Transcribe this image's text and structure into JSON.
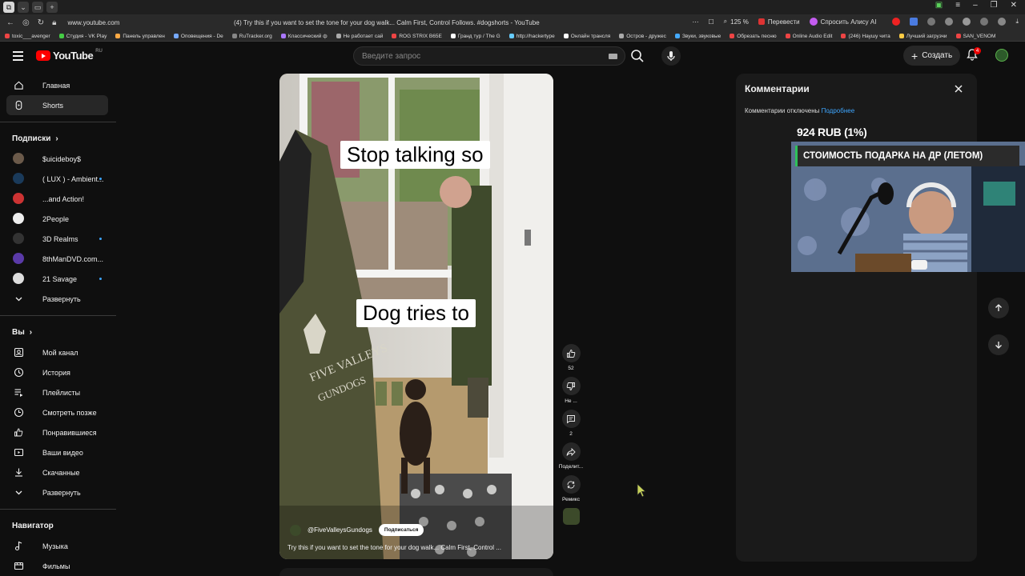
{
  "browser": {
    "url": "www.youtube.com",
    "page_title": "(4) Try this if you want to set the tone for your dog walk... Calm First, Control Follows. #dogshorts - YouTube",
    "zoom": "125 %",
    "translate": "Перевести",
    "ask_alice": "Спросить Алису AI",
    "bookmarks": [
      "toxic___avenger",
      "Студия - VK Play",
      "Панель управлен",
      "Оповещения - De",
      "RuTracker.org",
      "Классический ф",
      "Не работает сай",
      "ROG STRIX B65E",
      "Гранд тур / The G",
      "http://hackertype",
      "Онлайн трансля",
      "Остров - дружес",
      "Звуки, звуковые",
      "Обрезать песню",
      "Online Audio Edit",
      "(246) Наушу чита",
      "Лучший загрузчи",
      "SAN_VENOM"
    ]
  },
  "header": {
    "logo": "YouTube",
    "region": "RU",
    "search_placeholder": "Введите запрос",
    "create_label": "Создать",
    "notifications_count": "4"
  },
  "sidebar": {
    "main": [
      {
        "label": "Главная",
        "icon": "home-icon"
      },
      {
        "label": "Shorts",
        "icon": "shorts-icon"
      }
    ],
    "subs_title": "Подписки",
    "subs": [
      {
        "label": "$uicideboy$",
        "color": "#6b5a4a",
        "live": false
      },
      {
        "label": "( LUX ) - Ambient...",
        "color": "#1a3a5a",
        "live": true
      },
      {
        "label": "...and Action!",
        "color": "#c33",
        "live": false
      },
      {
        "label": "2People",
        "color": "#eee",
        "live": false
      },
      {
        "label": "3D Realms",
        "color": "#333",
        "live": true
      },
      {
        "label": "8thManDVD.com...",
        "color": "#5a3aa8",
        "live": false
      },
      {
        "label": "21 Savage",
        "color": "#ddd",
        "live": true
      },
      {
        "label": "Развернуть",
        "color": "",
        "live": false
      }
    ],
    "you_title": "Вы",
    "you": [
      {
        "label": "Мой канал",
        "icon": "channel-icon"
      },
      {
        "label": "История",
        "icon": "history-icon"
      },
      {
        "label": "Плейлисты",
        "icon": "playlists-icon"
      },
      {
        "label": "Смотреть позже",
        "icon": "watch-later-icon"
      },
      {
        "label": "Понравившиеся",
        "icon": "liked-icon"
      },
      {
        "label": "Ваши видео",
        "icon": "your-videos-icon"
      },
      {
        "label": "Скачанные",
        "icon": "downloads-icon"
      },
      {
        "label": "Развернуть",
        "icon": "expand-icon"
      }
    ],
    "nav_title": "Навигатор",
    "nav": [
      {
        "label": "Музыка",
        "icon": "music-icon"
      },
      {
        "label": "Фильмы",
        "icon": "films-icon"
      }
    ]
  },
  "video": {
    "caption_top": "Stop talking so",
    "caption_mid": "Dog tries to",
    "channel": "@FiveValleysGundogs",
    "subscribe": "Подписаться",
    "title": "Try this if you want to set the tone for your dog walk... Calm First, Control ...",
    "jacket_text_1": "FIVE VALLEYS",
    "jacket_text_2": "GUNDOGS"
  },
  "actions": {
    "like_count": "52",
    "dislike_label": "Не ...",
    "comments_count": "2",
    "share_label": "Поделит...",
    "remix_label": "Ремикс"
  },
  "comments": {
    "title": "Комментарии",
    "disabled_text": "Комментарии отключены",
    "more_link": "Подробнее"
  },
  "overlay": {
    "donation": "924 RUB (1%)",
    "goal": "СТОИМОСТЬ ПОДАРКА НА ДР (ЛЕТОМ)"
  }
}
